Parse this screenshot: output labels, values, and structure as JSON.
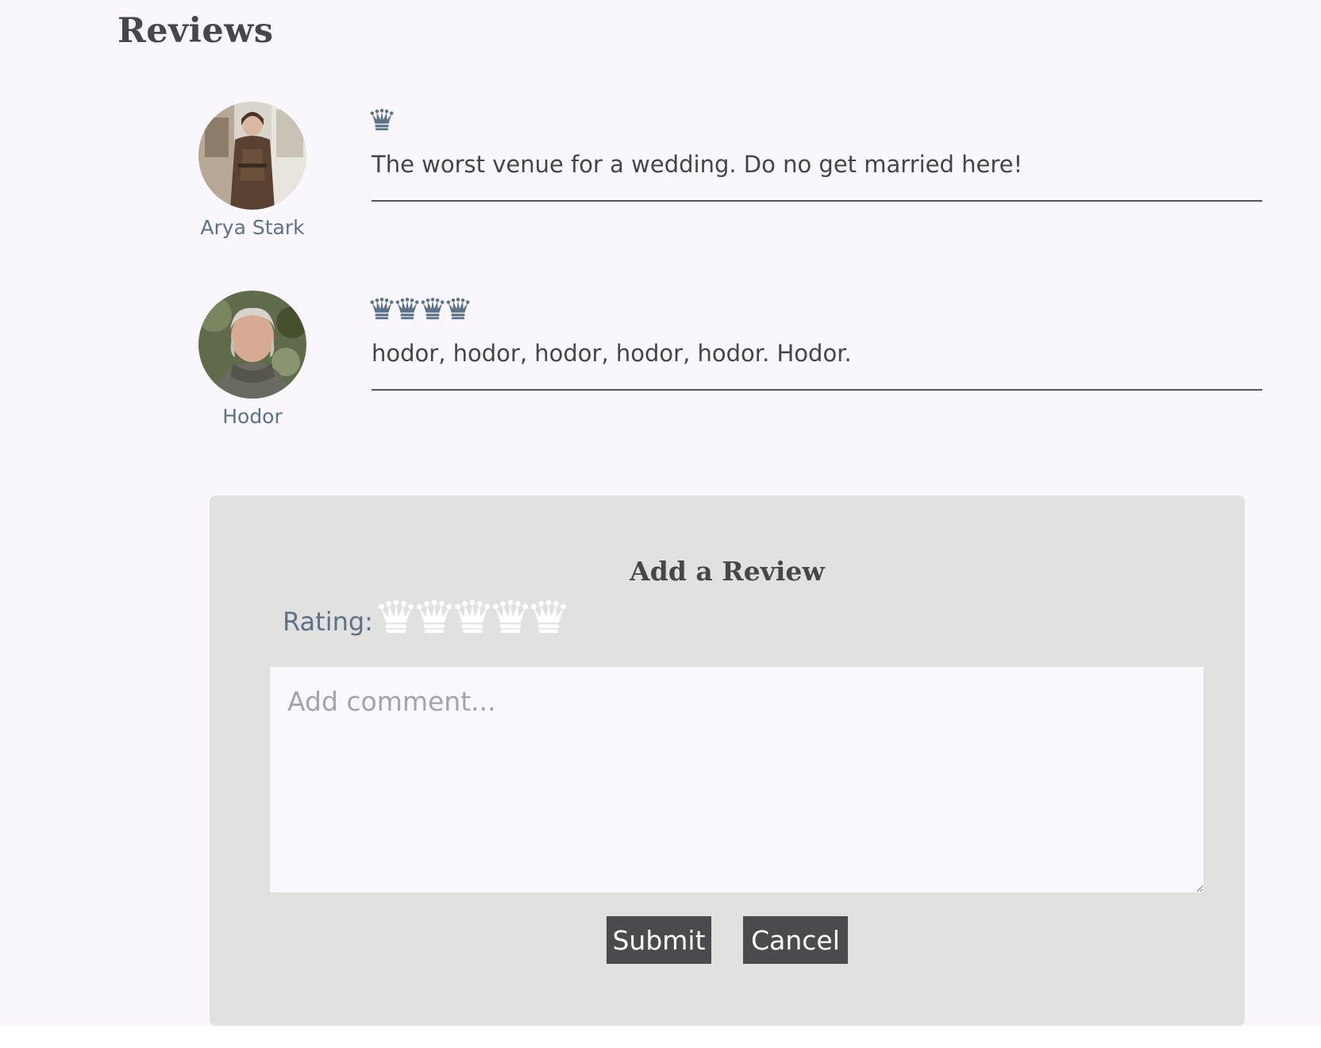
{
  "reviews_section": {
    "title": "Reviews",
    "items": [
      {
        "reviewer": "Arya Stark",
        "rating": 1,
        "comment": "The worst venue for a wedding. Do no get married here!"
      },
      {
        "reviewer": "Hodor",
        "rating": 4,
        "comment": "hodor, hodor, hodor, hodor, hodor. Hodor."
      }
    ]
  },
  "add_review": {
    "title": "Add a Review",
    "rating_label": "Rating:",
    "rating_max": 5,
    "rating_selected": 0,
    "comment_placeholder": "Add comment...",
    "submit_label": "Submit",
    "cancel_label": "Cancel"
  },
  "colors": {
    "crown_filled": "#5c7286",
    "crown_empty": "#ffffff",
    "accent_text": "#5c7286",
    "button_bg": "#4a4b4d",
    "panel_bg": "#e1e2df",
    "page_bg": "#f9f7fc"
  },
  "icons": {
    "rating": "crown-icon"
  }
}
